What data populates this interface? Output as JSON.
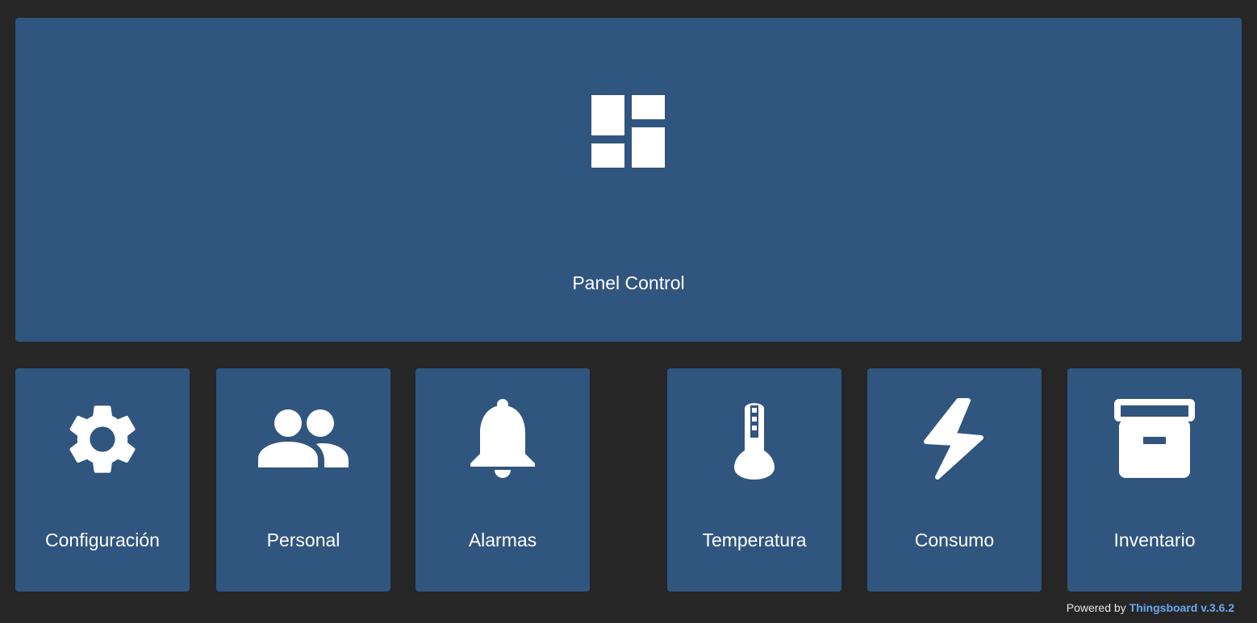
{
  "tiles": {
    "main": {
      "label": "Panel Control",
      "icon": "dashboard-icon"
    },
    "config": {
      "label": "Configuración",
      "icon": "gear-icon"
    },
    "personal": {
      "label": "Personal",
      "icon": "people-icon"
    },
    "alarmas": {
      "label": "Alarmas",
      "icon": "bell-icon"
    },
    "temperatura": {
      "label": "Temperatura",
      "icon": "thermometer-icon"
    },
    "consumo": {
      "label": "Consumo",
      "icon": "lightning-icon"
    },
    "inventario": {
      "label": "Inventario",
      "icon": "archive-box-icon"
    }
  },
  "footer": {
    "prefix": "Powered by",
    "link_text": "Thingsboard v.3.6.2"
  },
  "colors": {
    "background": "#262626",
    "tile": "#30557f",
    "link": "#6aa8f0"
  }
}
